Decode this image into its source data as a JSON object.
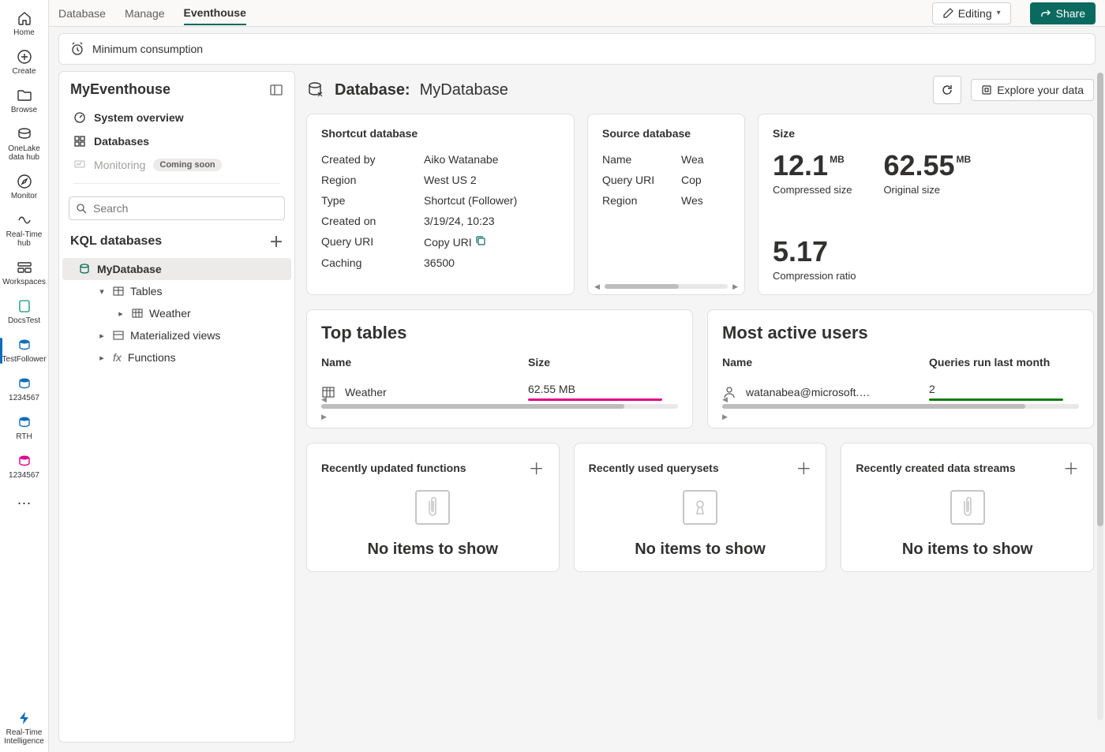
{
  "rail": {
    "items": [
      {
        "label": "Home",
        "icon": "home"
      },
      {
        "label": "Create",
        "icon": "plus-circle"
      },
      {
        "label": "Browse",
        "icon": "folder"
      },
      {
        "label": "OneLake data hub",
        "icon": "onelake"
      },
      {
        "label": "Monitor",
        "icon": "compass"
      },
      {
        "label": "Real-Time hub",
        "icon": "realtime"
      },
      {
        "label": "Workspaces",
        "icon": "workspaces"
      },
      {
        "label": "DocsTest",
        "icon": "doc"
      },
      {
        "label": "TestFollower",
        "icon": "db"
      },
      {
        "label": "1234567",
        "icon": "db"
      },
      {
        "label": "RTH",
        "icon": "db"
      },
      {
        "label": "1234567",
        "icon": "db-pink"
      }
    ],
    "activeIndex": 8,
    "footer": {
      "label": "Real-Time Intelligence",
      "icon": "bolt"
    }
  },
  "tabs": {
    "items": [
      "Database",
      "Manage",
      "Eventhouse"
    ],
    "activeIndex": 2,
    "editing_label": "Editing",
    "share_label": "Share"
  },
  "banner": {
    "text": "Minimum consumption"
  },
  "sidepanel": {
    "title": "MyEventhouse",
    "nav": [
      {
        "label": "System overview",
        "icon": "gauge"
      },
      {
        "label": "Databases",
        "icon": "grid"
      },
      {
        "label": "Monitoring",
        "icon": "monitor",
        "disabled": true,
        "pill": "Coming soon"
      }
    ],
    "search_placeholder": "Search",
    "section": "KQL databases",
    "tree": {
      "db": "MyDatabase",
      "tables_label": "Tables",
      "table_items": [
        "Weather"
      ],
      "matviews_label": "Materialized views",
      "functions_label": "Functions"
    }
  },
  "content": {
    "header": {
      "prefix": "Database:",
      "name": "MyDatabase",
      "explore_label": "Explore your data"
    },
    "shortcut": {
      "title": "Shortcut database",
      "rows": [
        {
          "k": "Created by",
          "v": "Aiko Watanabe"
        },
        {
          "k": "Region",
          "v": "West US 2"
        },
        {
          "k": "Type",
          "v": "Shortcut (Follower)"
        },
        {
          "k": "Created on",
          "v": "3/19/24, 10:23"
        },
        {
          "k": "Query URI",
          "v": "Copy URI",
          "link": true,
          "copy": true
        },
        {
          "k": "Caching",
          "v": "36500"
        }
      ]
    },
    "source": {
      "title": "Source database",
      "rows": [
        {
          "k": "Name",
          "v": "Wea",
          "link": true
        },
        {
          "k": "Query URI",
          "v": "Cop",
          "link": true
        },
        {
          "k": "Region",
          "v": "Wes"
        }
      ]
    },
    "size": {
      "title": "Size",
      "metrics": [
        {
          "big": "12.1",
          "unit": "MB",
          "sub": "Compressed size"
        },
        {
          "big": "62.55",
          "unit": "MB",
          "sub": "Original size"
        },
        {
          "big": "5.17",
          "unit": "",
          "sub": "Compression ratio"
        }
      ]
    },
    "top_tables": {
      "title": "Top tables",
      "col1": "Name",
      "col2": "Size",
      "rows": [
        {
          "name": "Weather",
          "size": "62.55 MB"
        }
      ]
    },
    "active_users": {
      "title": "Most active users",
      "col1": "Name",
      "col2": "Queries run last month",
      "rows": [
        {
          "name": "watanabea@microsoft.c...",
          "count": "2"
        }
      ]
    },
    "tiles": [
      {
        "title": "Recently updated functions",
        "empty": "No items to show",
        "icon": "clip"
      },
      {
        "title": "Recently used querysets",
        "empty": "No items to show",
        "icon": "keyhole"
      },
      {
        "title": "Recently created data streams",
        "empty": "No items to show",
        "icon": "clip"
      }
    ]
  }
}
